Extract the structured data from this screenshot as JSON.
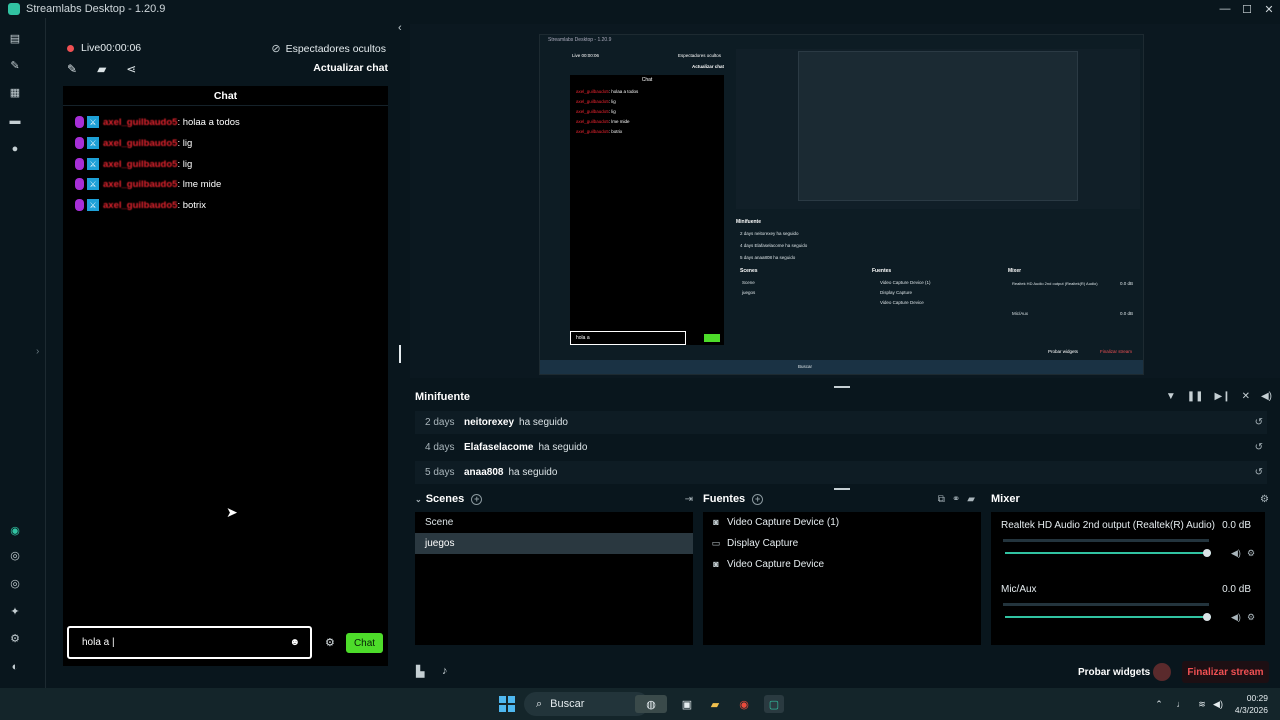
{
  "window": {
    "title": "Streamlabs Desktop - 1.20.9",
    "minimize": "—",
    "maximize": "☐",
    "close": "✕"
  },
  "leftnav": {
    "top_icons": [
      "editor-icon",
      "themes-icon",
      "store-icon",
      "media-icon",
      "record-icon"
    ],
    "bottom_icons": [
      "dashboard-icon",
      "prime-icon",
      "cloudbot-icon",
      "highlighter-icon",
      "settings-icon",
      "profile-icon"
    ]
  },
  "chat_panel": {
    "live_label": "Live",
    "live_timer": "00:00:06",
    "viewers_label": "Espectadores ocultos",
    "refresh_label": "Actualizar chat",
    "chat_title": "Chat",
    "messages": [
      {
        "user": "axel_guilbaudo5",
        "text": ": holaa a todos"
      },
      {
        "user": "axel_guilbaudo5",
        "text": ": lig"
      },
      {
        "user": "axel_guilbaudo5",
        "text": ": lig"
      },
      {
        "user": "axel_guilbaudo5",
        "text": ": lme mide"
      },
      {
        "user": "axel_guilbaudo5",
        "text": ": botrix"
      }
    ],
    "input_value": "hola a |",
    "chat_button": "Chat"
  },
  "preview": {
    "mini_title": "Streamlabs Desktop - 1.20.9",
    "mini_live": "Live 00:00:06",
    "mini_viewers": "Espectadores ocultos",
    "mini_refresh": "Actualizar chat",
    "mini_chat": "Chat",
    "mini_messages": [
      ": holaa a todos",
      ": lig",
      ": lig",
      ": lme mide",
      ": botrix"
    ],
    "mini_user": "axel_guilbaudo5",
    "mini_input": "hola a",
    "mini_minifuente": "Minifuente",
    "mini_events": [
      "2 days  neitorexey  ha seguido",
      "4 days  Elafaselacome  ha seguido",
      "5 days  anaa808  ha seguido"
    ],
    "mini_scenes": "Scenes",
    "mini_scene_items": [
      "Scene",
      "juegos"
    ],
    "mini_fuentes": "Fuentes",
    "mini_source_items": [
      "Video Capture Device (1)",
      "Display Capture",
      "Video Capture Device"
    ],
    "mini_mixer": "Mixer",
    "mini_mix_items": [
      "Realtek HD Audio 2nd output (Realtek(R) Audio)",
      "Mic/Aux"
    ],
    "mini_db": "0.0 dB",
    "mini_probar": "Probar widgets",
    "mini_end": "Finalizar stream",
    "mini_search": "Buscar"
  },
  "minifuente": {
    "title": "Minifuente",
    "events": [
      {
        "days": "2 days",
        "user": "neitorexey",
        "action": "ha seguido"
      },
      {
        "days": "4 days",
        "user": "Elafaselacome",
        "action": "ha seguido"
      },
      {
        "days": "5 days",
        "user": "anaa808",
        "action": "ha seguido"
      }
    ]
  },
  "scenes": {
    "title": "Scenes",
    "items": [
      "Scene",
      "juegos"
    ],
    "selected": "juegos"
  },
  "sources": {
    "title": "Fuentes",
    "items": [
      "Video Capture Device (1)",
      "Display Capture",
      "Video Capture Device"
    ]
  },
  "mixer": {
    "title": "Mixer",
    "channels": [
      {
        "name": "Realtek HD Audio 2nd output (Realtek(R) Audio)",
        "db": "0.0 dB",
        "level": 1.0
      },
      {
        "name": "Mic/Aux",
        "db": "0.0 dB",
        "level": 1.0
      }
    ]
  },
  "footer": {
    "test_widgets": "Probar widgets",
    "end_stream": "Finalizar stream"
  },
  "taskbar": {
    "search": "Buscar",
    "time": "00:29",
    "date": "4/3/2026"
  },
  "colors": {
    "accent": "#31c3a2",
    "live_red": "#f05053",
    "chat_green": "#4ddc2a",
    "username_red": "#e7242f"
  }
}
